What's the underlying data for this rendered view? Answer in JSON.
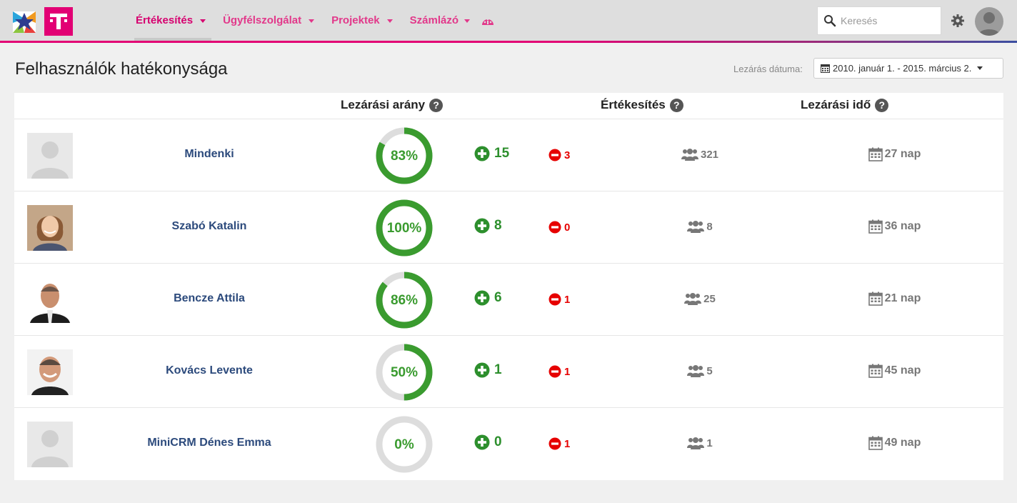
{
  "nav": {
    "items": [
      {
        "label": "Értékesítés",
        "active": true
      },
      {
        "label": "Ügyfélszolgálat",
        "active": false
      },
      {
        "label": "Projektek",
        "active": false
      },
      {
        "label": "Számlázó",
        "active": false
      }
    ]
  },
  "search": {
    "placeholder": "Keresés"
  },
  "page": {
    "title": "Felhasználók hatékonysága",
    "date_label": "Lezárás dátuma:",
    "date_range": "2010. január 1. - 2015. március 2."
  },
  "table": {
    "headers": {
      "closing_rate": "Lezárási arány",
      "sales": "Értékesítés",
      "closing_time": "Lezárási idő"
    },
    "rows": [
      {
        "name": "Mindenki",
        "photo": "placeholder",
        "rate": 83,
        "rate_label": "83%",
        "won": "15",
        "lost": "3",
        "sales": "321",
        "time": "27 nap"
      },
      {
        "name": "Szabó Katalin",
        "photo": "woman",
        "rate": 100,
        "rate_label": "100%",
        "won": "8",
        "lost": "0",
        "sales": "8",
        "time": "36 nap"
      },
      {
        "name": "Bencze Attila",
        "photo": "man-bald",
        "rate": 86,
        "rate_label": "86%",
        "won": "6",
        "lost": "1",
        "sales": "25",
        "time": "21 nap"
      },
      {
        "name": "Kovács Levente",
        "photo": "man-smile",
        "rate": 50,
        "rate_label": "50%",
        "won": "1",
        "lost": "1",
        "sales": "5",
        "time": "45 nap"
      },
      {
        "name": "MiniCRM Dénes Emma",
        "photo": "placeholder",
        "rate": 0,
        "rate_label": "0%",
        "won": "0",
        "lost": "1",
        "sales": "1",
        "time": "49 nap"
      }
    ]
  },
  "colors": {
    "brand": "#e20074",
    "success": "#2d8f2d",
    "danger": "#e60000",
    "donut_bg": "#dddddd",
    "donut_fg": "#3a9b2f"
  }
}
